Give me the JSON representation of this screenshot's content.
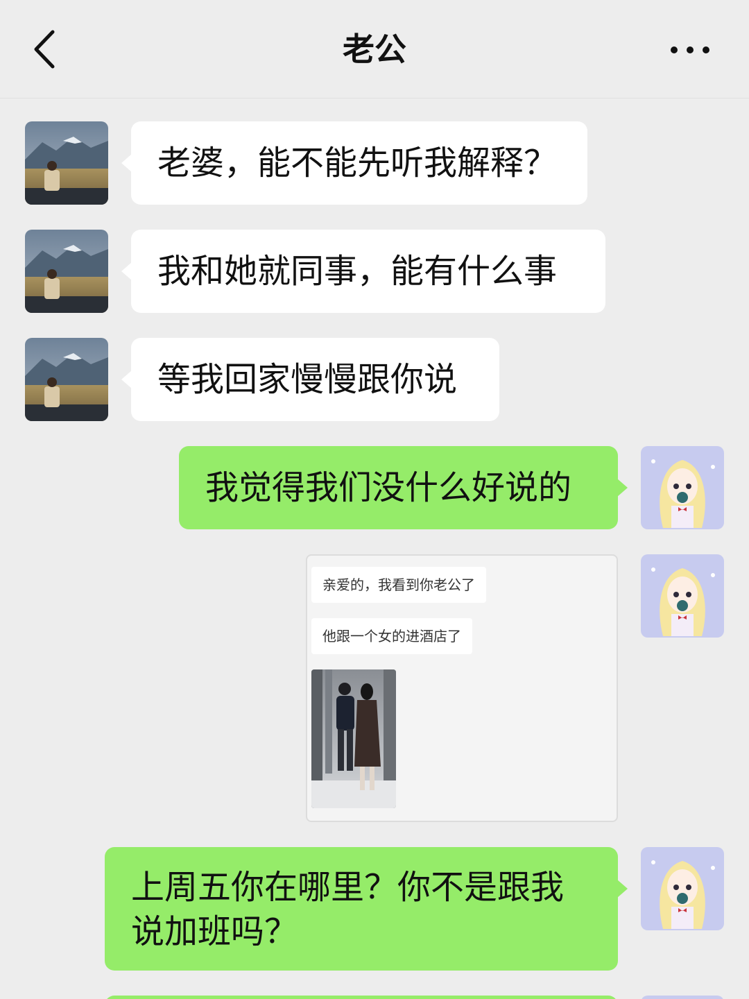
{
  "header": {
    "title": "老公",
    "back_icon": "chevron-left-icon",
    "more_icon": "more-dots-icon"
  },
  "messages": [
    {
      "sender": "contact",
      "text": "老婆，能不能先听我解释？"
    },
    {
      "sender": "contact",
      "text": "我和她就同事，能有什么事"
    },
    {
      "sender": "contact",
      "text": "等我回家慢慢跟你说"
    },
    {
      "sender": "me",
      "text": "我觉得我们没什么好说的"
    },
    {
      "sender": "me",
      "type": "screenshot",
      "screenshot": {
        "line1": "亲爱的，我看到你老公了",
        "line2": "他跟一个女的进酒店了"
      }
    },
    {
      "sender": "me",
      "text_line1": "上周五你在哪里？你不是跟我",
      "text_line2": "说加班吗？"
    }
  ],
  "colors": {
    "background": "#EDEDED",
    "incoming_bubble": "#FFFFFF",
    "outgoing_bubble": "#95EC69"
  }
}
